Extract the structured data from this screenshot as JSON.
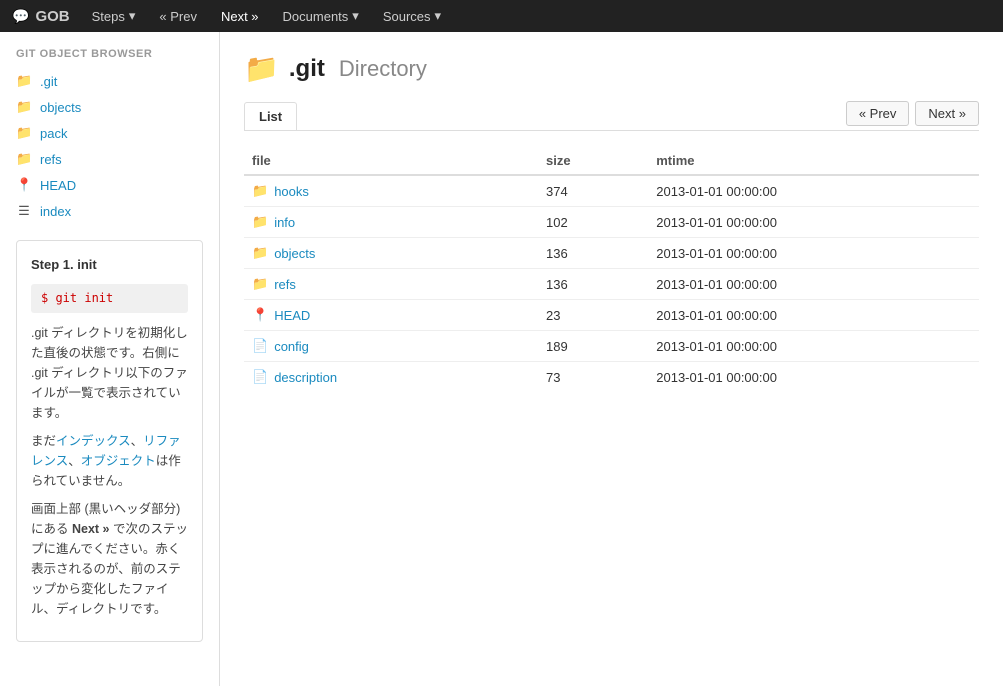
{
  "navbar": {
    "brand": "GOB",
    "bubble_symbol": "💬",
    "steps_label": "Steps",
    "prev_label": "« Prev",
    "next_label": "Next »",
    "documents_label": "Documents",
    "sources_label": "Sources"
  },
  "sidebar": {
    "title": "GIT OBJECT BROWSER",
    "items": [
      {
        "id": "dot-git",
        "label": ".git",
        "icon": "folder",
        "type": "folder"
      },
      {
        "id": "objects",
        "label": "objects",
        "icon": "folder",
        "type": "folder"
      },
      {
        "id": "pack",
        "label": "pack",
        "icon": "folder",
        "type": "folder"
      },
      {
        "id": "refs",
        "label": "refs",
        "icon": "folder",
        "type": "folder"
      },
      {
        "id": "HEAD",
        "label": "HEAD",
        "icon": "pin",
        "type": "special"
      },
      {
        "id": "index",
        "label": "index",
        "icon": "list",
        "type": "special"
      }
    ]
  },
  "step_box": {
    "title": "Step 1. init",
    "command": "$ git init",
    "paragraphs": [
      ".git ディレクトリを初期化した直後の状態です。右側に .git ディレクトリ以下のファイルが一覧で表示されています。",
      "まだインデックス、リファレンス、オブジェクトは作られていません。",
      "画面上部 (黒いヘッダ部分) にある Next » で次のステップに進んでください。赤く表示されるのが、前のステップから変化したファイル、ディレクトリです。"
    ],
    "links": [
      {
        "text": "インデックス",
        "id": "link-index"
      },
      {
        "text": "リファレンス",
        "id": "link-reference"
      },
      {
        "text": "オブジェクト",
        "id": "link-object"
      }
    ]
  },
  "main": {
    "folder_icon": "📁",
    "title": ".git",
    "subtitle": "Directory",
    "tab_label": "List",
    "prev_btn": "« Prev",
    "next_btn": "Next »",
    "table": {
      "headers": [
        "file",
        "size",
        "mtime"
      ],
      "rows": [
        {
          "name": "hooks",
          "icon": "folder",
          "size": "374",
          "mtime": "2013-01-01 00:00:00",
          "type": "folder"
        },
        {
          "name": "info",
          "icon": "folder",
          "size": "102",
          "mtime": "2013-01-01 00:00:00",
          "type": "folder"
        },
        {
          "name": "objects",
          "icon": "folder",
          "size": "136",
          "mtime": "2013-01-01 00:00:00",
          "type": "folder"
        },
        {
          "name": "refs",
          "icon": "folder",
          "size": "136",
          "mtime": "2013-01-01 00:00:00",
          "type": "folder"
        },
        {
          "name": "HEAD",
          "icon": "pin",
          "size": "23",
          "mtime": "2013-01-01 00:00:00",
          "type": "special"
        },
        {
          "name": "config",
          "icon": "doc",
          "size": "189",
          "mtime": "2013-01-01 00:00:00",
          "type": "file"
        },
        {
          "name": "description",
          "icon": "doc",
          "size": "73",
          "mtime": "2013-01-01 00:00:00",
          "type": "file"
        }
      ]
    }
  }
}
